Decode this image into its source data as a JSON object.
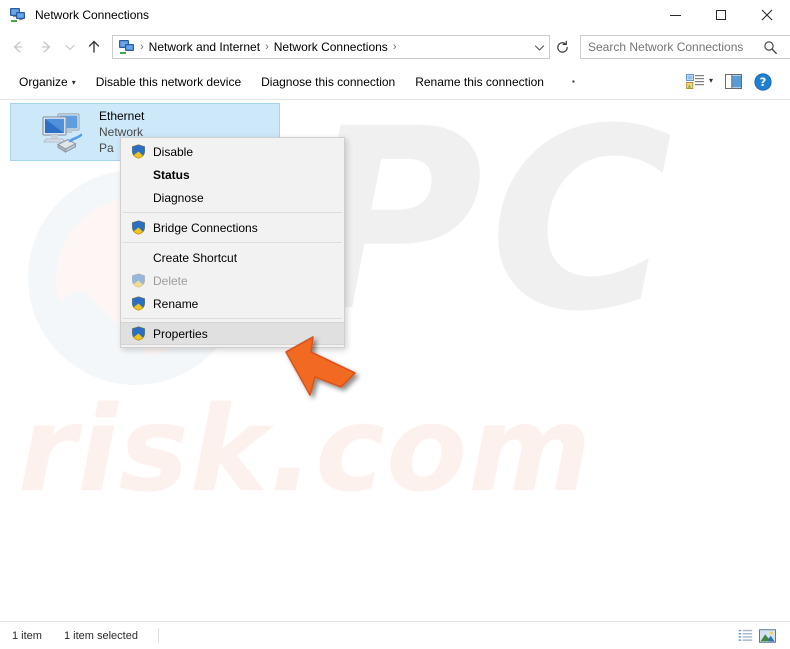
{
  "window": {
    "title": "Network Connections",
    "icon": "network-connections-icon",
    "controls": {
      "minimize": "minimize-button",
      "maximize": "maximize-button",
      "close": "close-button"
    }
  },
  "navigation": {
    "back": "back-button",
    "forward": "forward-button",
    "recent": "recent-locations-button",
    "up": "up-button",
    "refresh": "refresh-button",
    "breadcrumb": {
      "icon": "network-icon",
      "separator": "›",
      "items": [
        {
          "label": "Network and Internet"
        },
        {
          "label": "Network Connections"
        }
      ],
      "dropdown": "⌄"
    }
  },
  "search": {
    "placeholder": "Search Network Connections",
    "value": "",
    "icon": "search-icon"
  },
  "commandbar": {
    "items": [
      {
        "label": "Organize",
        "has_caret": true
      },
      {
        "label": "Disable this network device",
        "has_caret": false
      },
      {
        "label": "Diagnose this connection",
        "has_caret": false
      },
      {
        "label": "Rename this connection",
        "has_caret": false
      }
    ],
    "overflow": "▪",
    "caret": "▾",
    "view_button": "change-view-button",
    "view_caret": "▾",
    "preview_pane_button": "preview-pane-button",
    "help_button": "help-button",
    "help_glyph": "?"
  },
  "content": {
    "item": {
      "name": "Ethernet",
      "network": "Network",
      "adapter": "Pa",
      "icon": "ethernet-adapter-icon",
      "selected": true
    }
  },
  "context_menu": {
    "entries": [
      {
        "label": "Disable",
        "shield": true,
        "bold": false,
        "disabled": false,
        "highlight": false,
        "separator_after": false
      },
      {
        "label": "Status",
        "shield": false,
        "bold": true,
        "disabled": false,
        "highlight": false,
        "separator_after": false
      },
      {
        "label": "Diagnose",
        "shield": false,
        "bold": false,
        "disabled": false,
        "highlight": false,
        "separator_after": true
      },
      {
        "label": "Bridge Connections",
        "shield": true,
        "bold": false,
        "disabled": false,
        "highlight": false,
        "separator_after": true
      },
      {
        "label": "Create Shortcut",
        "shield": false,
        "bold": false,
        "disabled": false,
        "highlight": false,
        "separator_after": false
      },
      {
        "label": "Delete",
        "shield": true,
        "bold": false,
        "disabled": true,
        "highlight": false,
        "separator_after": false
      },
      {
        "label": "Rename",
        "shield": true,
        "bold": false,
        "disabled": false,
        "highlight": false,
        "separator_after": true
      },
      {
        "label": "Properties",
        "shield": true,
        "bold": false,
        "disabled": false,
        "highlight": true,
        "separator_after": false
      }
    ]
  },
  "statusbar": {
    "item_count": "1 item",
    "selection": "1 item selected",
    "details_view_button": "details-view-button",
    "large_icons_view_button": "large-icons-view-button"
  },
  "watermark": {
    "primary": "PC",
    "secondary": "risk.com",
    "primary_color": "#f0f0f0",
    "secondary_color": "#fdf1ed"
  },
  "cursor": {
    "name": "orange-arrow-cursor",
    "color": "#f26a21"
  }
}
